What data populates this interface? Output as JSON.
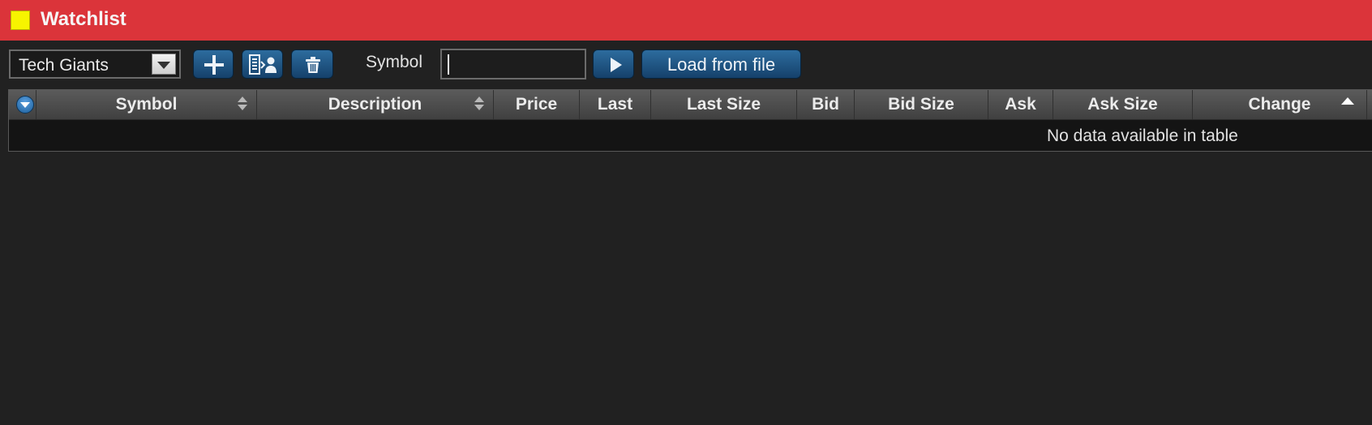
{
  "window": {
    "title": "Watchlist",
    "swatch_color": "#f7f400",
    "accent_color": "#db343a"
  },
  "toolbar": {
    "list_select": {
      "value": "Tech Giants"
    },
    "buttons": {
      "add": {
        "icon": "plus-icon"
      },
      "manage": {
        "icon": "list-user-icon"
      },
      "delete": {
        "icon": "trash-icon"
      },
      "go": {
        "icon": "play-icon"
      },
      "load_label": "Load from file"
    },
    "symbol_label": "Symbol",
    "symbol_value": ""
  },
  "table": {
    "columns": [
      "Symbol",
      "Description",
      "Price",
      "Last",
      "Last Size",
      "Bid",
      "Bid Size",
      "Ask",
      "Ask Size",
      "Change"
    ],
    "sorted_column": "Change",
    "sort_direction": "ascending",
    "empty_message": "No data available in table"
  }
}
